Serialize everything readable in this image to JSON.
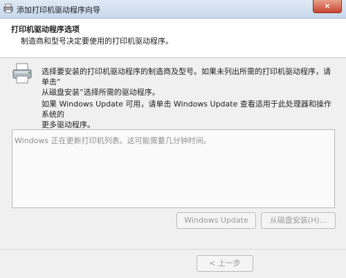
{
  "window": {
    "title": "添加打印机驱动程序向导",
    "close_label": "×"
  },
  "header": {
    "title": "打印机驱动程序选项",
    "subtitle": "制造商和型号决定要使用的打印机驱动程序。"
  },
  "body": {
    "description_1_line1": "选择要安装的打印机驱动程序的制造商及型号。如果未列出所需的打印机驱动程序，请单击“",
    "description_1_line2": "从磁盘安装”选择所需的驱动程序。",
    "description_2_line1": "如果 Windows Update 可用，请单击 Windows Update 查看适用于此处理器和操作系统的",
    "description_2_line2": "更多驱动程序。"
  },
  "list": {
    "status_text": "Windows 正在更新打印机列表。这可能需要几分钟时间。"
  },
  "buttons": {
    "windows_update": "Windows Update",
    "have_disk": "从磁盘安装(H)...",
    "back": "< 上一步"
  }
}
